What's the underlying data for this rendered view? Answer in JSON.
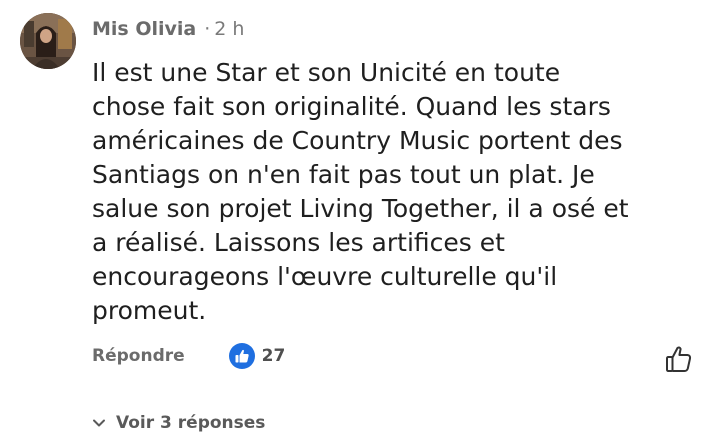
{
  "comment": {
    "author": "Mis Olivia",
    "separator": "·",
    "time": "2 h",
    "body_lines": [
      "Il est une Star et son Unicité en toute",
      "chose fait son originalité. Quand les stars",
      "américaines de Country Music portent des",
      "Santiags on n'en fait pas tout un plat. Je",
      "salue son projet Living Together, il a osé et",
      "a réalisé. Laissons les artifices et",
      "encourageons l'œuvre culturelle qu'il",
      "promeut."
    ],
    "reply_label": "Répondre",
    "like_count": "27",
    "replies_label": "Voir 3 réponses"
  },
  "icons": {
    "avatar": "avatar-photo",
    "reaction": "thumbs-up-icon",
    "like_button": "thumbs-up-outline-icon",
    "expand": "chevron-down-icon"
  },
  "colors": {
    "reaction_badge": "#1f6fe0",
    "text": "#1f1f1f",
    "muted": "#6b6b6b"
  }
}
